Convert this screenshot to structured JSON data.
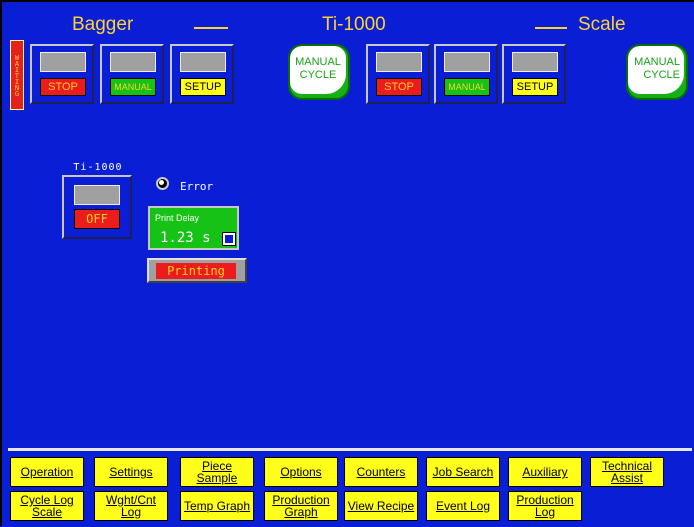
{
  "header": {
    "left_title": "Bagger",
    "center_title": "Ti-1000",
    "right_title": "Scale"
  },
  "status_vertical": "WAITING",
  "bagger_controls": {
    "stop_label": "STOP",
    "manual_label": "MANUAL",
    "setup_label": "SETUP",
    "manual_cycle_label": "MANUAL CYCLE"
  },
  "scale_controls": {
    "stop_label": "STOP",
    "manual_label": "MANUAL",
    "setup_label": "SETUP",
    "manual_cycle_label": "MANUAL CYCLE"
  },
  "ti_panel": {
    "title": "Ti-1000",
    "state_label": "OFF",
    "error_label": "Error",
    "print_delay_title": "Print Delay",
    "print_delay_value": "1.23 s",
    "printing_label": "Printing"
  },
  "nav": {
    "row1": [
      "Operation",
      "Settings",
      "Piece Sample",
      "Options",
      "Counters",
      "Job Search",
      "Auxiliary",
      "Technical Assist"
    ],
    "row2": [
      "Cycle Log Scale",
      "Wght/Cnt Log",
      "Temp Graph",
      "Production Graph",
      "View Recipe",
      "Event Log",
      "Production Log"
    ]
  },
  "colors": {
    "background": "#0a1ed6",
    "accent_yellow": "#ffd32a",
    "stop_red": "#ec1c1c",
    "manual_green": "#15c215",
    "button_yellow": "#ffff1a"
  }
}
